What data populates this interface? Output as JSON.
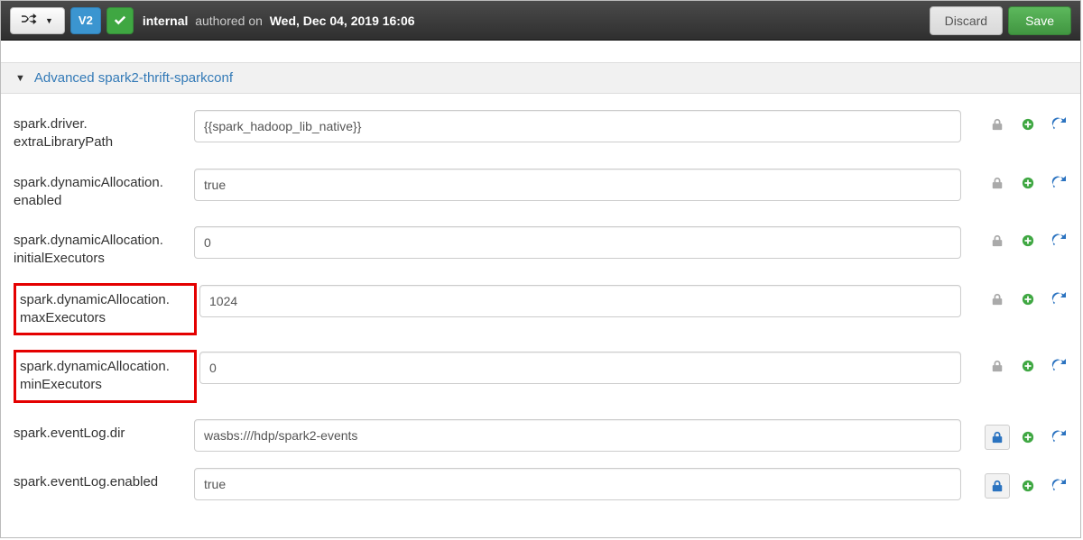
{
  "header": {
    "version_label": "V2",
    "user": "internal",
    "authored_label": "authored on",
    "date": "Wed, Dec 04, 2019 16:06",
    "discard": "Discard",
    "save": "Save"
  },
  "section": {
    "title": "Advanced spark2-thrift-sparkconf"
  },
  "props": [
    {
      "label_a": "spark.driver.",
      "label_b": "extraLibraryPath",
      "value": "{{spark_hadoop_lib_native}}",
      "locked": false,
      "highlight": false
    },
    {
      "label_a": "spark.dynamicAllocation.",
      "label_b": "enabled",
      "value": "true",
      "locked": false,
      "highlight": false
    },
    {
      "label_a": "spark.dynamicAllocation.",
      "label_b": "initialExecutors",
      "value": "0",
      "locked": false,
      "highlight": false
    },
    {
      "label_a": "spark.dynamicAllocation.",
      "label_b": "maxExecutors",
      "value": "1024",
      "locked": false,
      "highlight": true
    },
    {
      "label_a": "spark.dynamicAllocation.",
      "label_b": "minExecutors",
      "value": "0",
      "locked": false,
      "highlight": true
    },
    {
      "label_a": "spark.eventLog.dir",
      "label_b": "",
      "value": "wasbs:///hdp/spark2-events",
      "locked": true,
      "highlight": false
    },
    {
      "label_a": "spark.eventLog.enabled",
      "label_b": "",
      "value": "true",
      "locked": true,
      "highlight": false
    }
  ]
}
